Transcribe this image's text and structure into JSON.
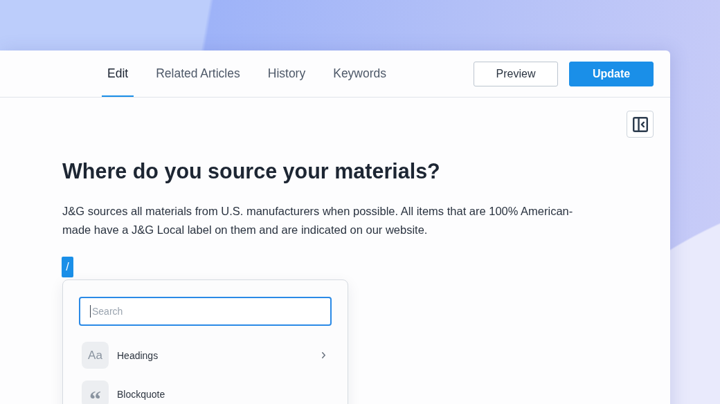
{
  "tabs": [
    {
      "label": "Edit",
      "selected": true
    },
    {
      "label": "Related Articles",
      "selected": false
    },
    {
      "label": "History",
      "selected": false
    },
    {
      "label": "Keywords",
      "selected": false
    }
  ],
  "actions": [
    {
      "label": "Preview",
      "kind": "secondary"
    },
    {
      "label": "Update",
      "kind": "primary"
    }
  ],
  "editor": {
    "title": "Where do you source your materials?",
    "body": "J&G sources all materials from U.S. manufacturers when possible. All items that are 100% American-made have a J&G Local label on them and are indicated on our website.",
    "slash_command": {
      "text": "/",
      "highlighted": true
    }
  },
  "insert_menu": {
    "search": {
      "placeholder": "Search",
      "focused": true
    },
    "items": [
      {
        "glyph": "Aa",
        "label": "Headings",
        "has_submenu": true
      },
      {
        "glyph": "“",
        "label": "Blockquote",
        "has_submenu": false
      }
    ]
  }
}
